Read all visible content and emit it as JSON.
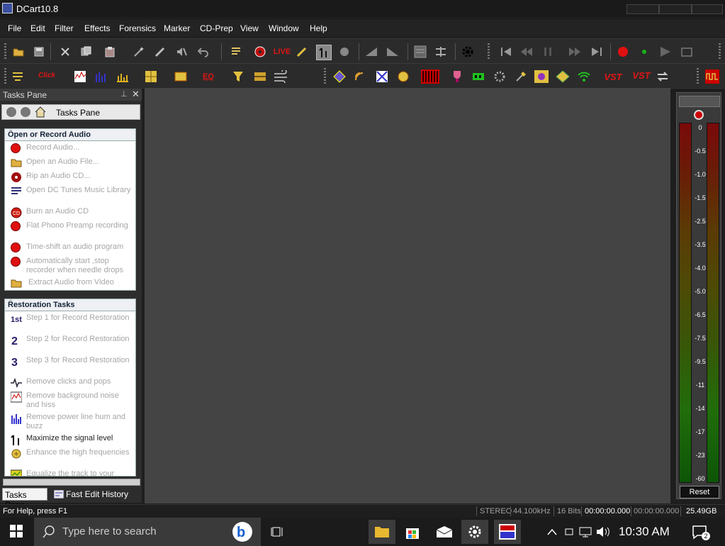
{
  "window": {
    "title": "DCart10.8"
  },
  "menu": [
    "File",
    "Edit",
    "Filter",
    "Effects",
    "Forensics",
    "Marker",
    "CD-Prep",
    "View",
    "Window",
    "Help"
  ],
  "toolbar2": {
    "click_label": "Click",
    "live_label": "LIVE",
    "eq_label": "EQ",
    "vst_label": "VST",
    "vst2_label": "VST"
  },
  "tasks_pane": {
    "header": "Tasks Pane",
    "nav_title": "Tasks Pane",
    "sections": [
      {
        "title": "Open or Record Audio",
        "items": [
          {
            "icon": "record-icon",
            "label": "Record Audio..."
          },
          {
            "icon": "open-folder-icon",
            "label": "Open an Audio File..."
          },
          {
            "icon": "cd-rip-icon",
            "label": "Rip an Audio CD..."
          },
          {
            "icon": "music-library-icon",
            "label": "Open DC Tunes Music Library"
          },
          {
            "icon": "cd-burn-icon",
            "label": "Burn an Audio CD"
          },
          {
            "icon": "record-icon",
            "label": "Flat Phono Preamp recording"
          },
          {
            "icon": "record-icon",
            "label": "Time-shift an audio program"
          },
          {
            "icon": "record-icon",
            "label": "Automatically start ,stop recorder when needle drops"
          },
          {
            "icon": "open-folder-icon",
            "label": "Extract Audio from Video"
          }
        ]
      },
      {
        "title": "Restoration Tasks",
        "items": [
          {
            "icon": "step1-icon",
            "label": "Step 1 for Record Restoration"
          },
          {
            "icon": "step2-icon",
            "label": "Step 2 for Record Restoration"
          },
          {
            "icon": "step3-icon",
            "label": "Step 3 for Record Restoration"
          },
          {
            "icon": "click-removal-icon",
            "label": "Remove clicks and pops"
          },
          {
            "icon": "noise-icon",
            "label": "Remove background noise and hiss"
          },
          {
            "icon": "hum-icon",
            "label": "Remove power line hum and buzz"
          },
          {
            "icon": "maximize-icon",
            "label": "Maximize the signal level"
          },
          {
            "icon": "enhance-icon",
            "label": "Enhance the high frequencies"
          },
          {
            "icon": "equalize-icon",
            "label": "Equalize the track to your"
          }
        ]
      }
    ],
    "tabs": [
      "Tasks Pane",
      "Fast Edit History"
    ]
  },
  "meter": {
    "ticks": [
      "0",
      "-0.5",
      "-1.0",
      "-1.5",
      "-2.5",
      "-3.5",
      "-4.0",
      "-5.0",
      "-6.5",
      "-7.5",
      "-9.5",
      "-11",
      "-14",
      "-17",
      "-23",
      "-60"
    ],
    "reset_label": "Reset"
  },
  "status": {
    "help": "For Help, press F1",
    "mode": "STEREO",
    "rate": "44.100kHz",
    "bits": "16 Bits",
    "pos": "00:00:00.000",
    "len": "00:00:00.000",
    "free": "25.49GB"
  },
  "taskbar": {
    "search_placeholder": "Type here to search",
    "time": "10:30 AM",
    "badge": "2"
  }
}
